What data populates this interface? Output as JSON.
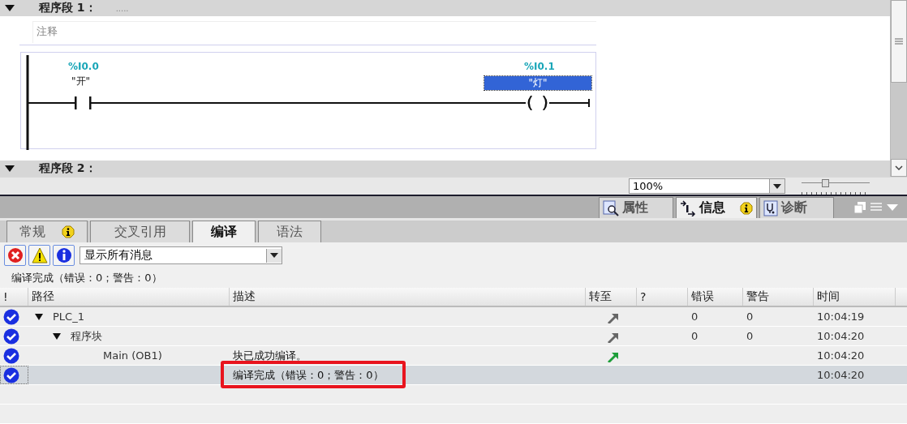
{
  "editor": {
    "networks": [
      {
        "title": "程序段 1：",
        "comment_hint": ".....",
        "comment_placeholder": "注释",
        "expanded": true
      },
      {
        "title": "程序段 2：",
        "expanded": true
      }
    ],
    "contact": {
      "address": "%I0.0",
      "tag": "\"开\""
    },
    "coil": {
      "address": "%I0.1",
      "tag": "\"灯\"",
      "selected": true
    },
    "zoom": {
      "value": "100%",
      "level": 0.35
    }
  },
  "inspector_tabs": [
    {
      "label": "属性",
      "badge": false,
      "selected": false
    },
    {
      "label": "信息",
      "badge": true,
      "selected": true
    },
    {
      "label": "诊断",
      "badge": false,
      "selected": false
    }
  ],
  "sub_tabs": [
    {
      "label": "常规",
      "badge": true,
      "selected": false
    },
    {
      "label": "交叉引用",
      "badge": false,
      "selected": false
    },
    {
      "label": "编译",
      "badge": false,
      "selected": true
    },
    {
      "label": "语法",
      "badge": false,
      "selected": false
    }
  ],
  "filter": {
    "value": "显示所有消息"
  },
  "status": "编译完成（错误：0；警告：0）",
  "table": {
    "columns": [
      "!",
      "路径",
      "描述",
      "转至",
      "?",
      "错误",
      "警告",
      "时间"
    ],
    "rows": [
      {
        "path": "PLC_1",
        "expanded": true,
        "goto": {
          "color": "#666666"
        },
        "errors": "0",
        "warnings": "0",
        "time": "10:04:19",
        "selected": false,
        "highlighted": false,
        "children": [
          {
            "path": "程序块",
            "expanded": true,
            "goto": {
              "color": "#666666"
            },
            "errors": "0",
            "warnings": "0",
            "time": "10:04:20",
            "selected": false,
            "highlighted": false,
            "children": [
              {
                "path": "Main (OB1)",
                "description": "块已成功编译。",
                "goto": {
                  "color": "#1e9e3a"
                },
                "time": "10:04:20",
                "selected": false,
                "highlighted": false
              }
            ]
          }
        ]
      },
      {
        "description": "编译完成（错误：0；警告：0）",
        "time": "10:04:20",
        "selected": true,
        "highlighted": true
      }
    ]
  }
}
